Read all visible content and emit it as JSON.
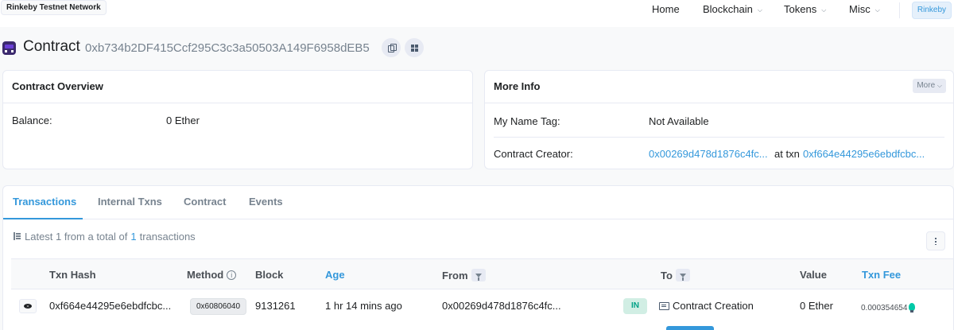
{
  "network": "Rinkeby Testnet Network",
  "nav": {
    "items": [
      {
        "label": "Home",
        "dropdown": false
      },
      {
        "label": "Blockchain",
        "dropdown": true
      },
      {
        "label": "Tokens",
        "dropdown": true
      },
      {
        "label": "Misc",
        "dropdown": true
      }
    ],
    "network_button": "Rinkeby"
  },
  "page": {
    "title": "Contract",
    "address": "0xb734b2DF415Ccf295C3c3a50503A149F6958dEB5"
  },
  "overview": {
    "title": "Contract Overview",
    "balance_label": "Balance:",
    "balance_value": "0 Ether"
  },
  "more_info": {
    "title": "More Info",
    "more_button": "More",
    "name_tag_label": "My Name Tag:",
    "name_tag_value": "Not Available",
    "creator_label": "Contract Creator:",
    "creator_address": "0x00269d478d1876c4fc...",
    "creator_at": "at txn",
    "creator_txn": "0xf664e44295e6ebdfcbc..."
  },
  "tabs": [
    {
      "label": "Transactions",
      "active": true
    },
    {
      "label": "Internal Txns",
      "active": false
    },
    {
      "label": "Contract",
      "active": false
    },
    {
      "label": "Events",
      "active": false
    }
  ],
  "summary": {
    "prefix": "Latest 1 from a total of",
    "count": "1",
    "suffix": "transactions"
  },
  "table": {
    "headers": {
      "txn_hash": "Txn Hash",
      "method": "Method",
      "block": "Block",
      "age": "Age",
      "from": "From",
      "to": "To",
      "value": "Value",
      "txn_fee": "Txn Fee"
    },
    "rows": [
      {
        "txn_hash": "0xf664e44295e6ebdfcbc...",
        "method": "0x60806040",
        "block": "9131261",
        "age": "1 hr 14 mins ago",
        "from": "0x00269d478d1876c4fc...",
        "direction": "IN",
        "to": "Contract Creation",
        "value": "0 Ether",
        "txn_fee": "0.000354654"
      }
    ]
  },
  "colors": {
    "link": "#3498db",
    "in_badge_bg": "#d1eee4",
    "in_badge_text": "#00a186"
  }
}
